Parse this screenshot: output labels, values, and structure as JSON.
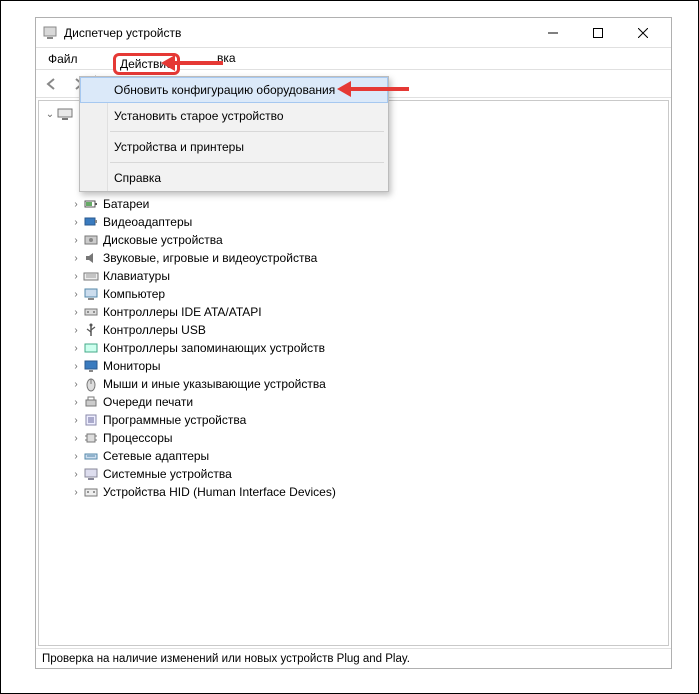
{
  "window": {
    "title": "Диспетчер устройств"
  },
  "menubar": {
    "file": "Файл",
    "action": "Действие",
    "tail_fragment": "вка"
  },
  "dropdown": {
    "scan": "Обновить конфигурацию оборудования",
    "legacy": "Установить старое устройство",
    "printers": "Устройства и принтеры",
    "help": "Справка"
  },
  "tree": {
    "items": [
      {
        "label": "Батареи"
      },
      {
        "label": "Видеоадаптеры"
      },
      {
        "label": "Дисковые устройства"
      },
      {
        "label": "Звуковые, игровые и видеоустройства"
      },
      {
        "label": "Клавиатуры"
      },
      {
        "label": "Компьютер"
      },
      {
        "label": "Контроллеры IDE ATA/ATAPI"
      },
      {
        "label": "Контроллеры USB"
      },
      {
        "label": "Контроллеры запоминающих устройств"
      },
      {
        "label": "Мониторы"
      },
      {
        "label": "Мыши и иные указывающие устройства"
      },
      {
        "label": "Очереди печати"
      },
      {
        "label": "Программные устройства"
      },
      {
        "label": "Процессоры"
      },
      {
        "label": "Сетевые адаптеры"
      },
      {
        "label": "Системные устройства"
      },
      {
        "label": "Устройства HID (Human Interface Devices)"
      }
    ]
  },
  "status": "Проверка на наличие изменений или новых устройств Plug and Play."
}
